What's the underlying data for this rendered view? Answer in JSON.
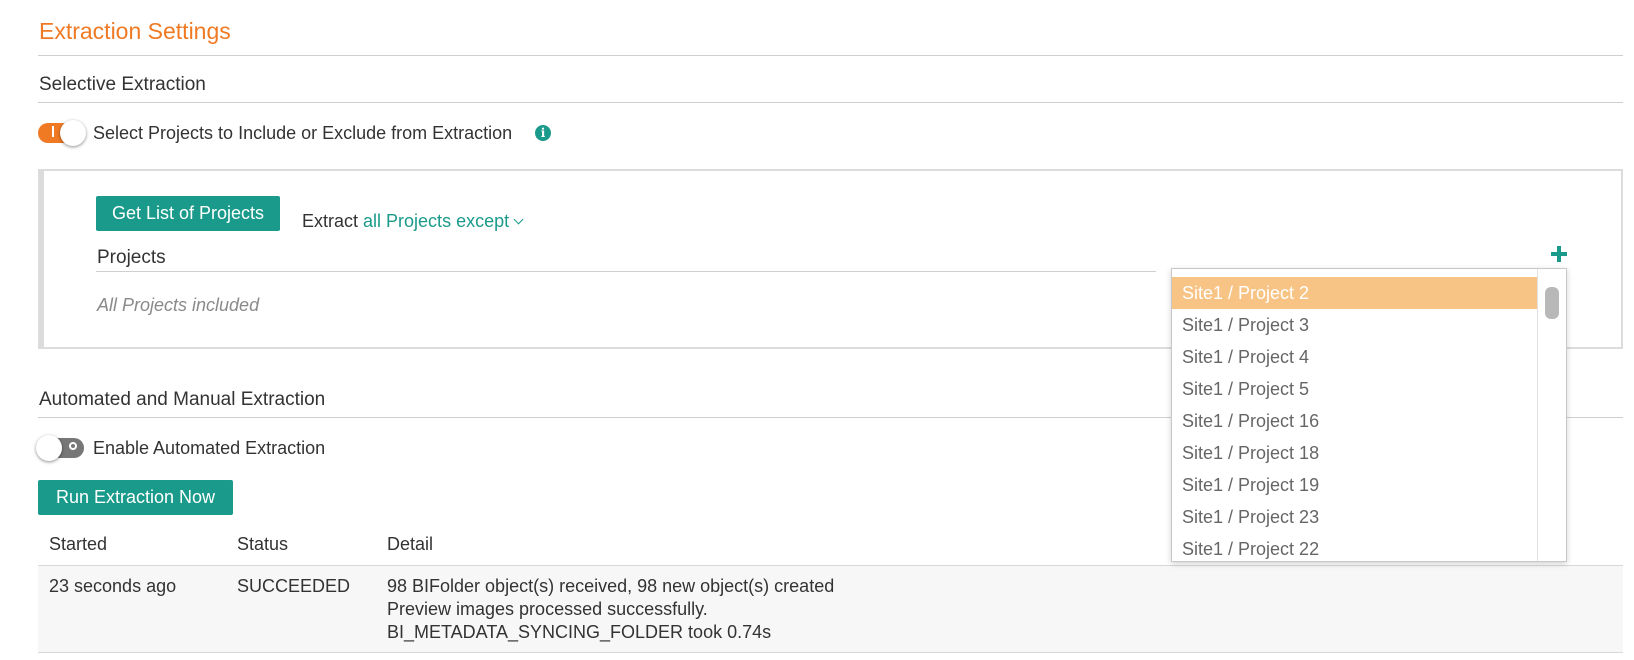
{
  "page": {
    "title": "Extraction Settings"
  },
  "selective": {
    "heading": "Selective Extraction",
    "toggle_state": "on",
    "toggle_label": "Select Projects to Include or Exclude from Extraction",
    "info_icon": "info-icon",
    "get_list_button": "Get List of Projects",
    "extract_prefix": "Extract",
    "extract_mode": "all Projects except",
    "projects_heading": "Projects",
    "projects_empty": "All Projects included",
    "add_icon": "plus-icon"
  },
  "dropdown": {
    "selected_index": 0,
    "items": [
      "Site1 / Project 2",
      "Site1 / Project 3",
      "Site1 / Project 4",
      "Site1 / Project 5",
      "Site1 / Project 16",
      "Site1 / Project 18",
      "Site1 / Project 19",
      "Site1 / Project 23",
      "Site1 / Project 22"
    ]
  },
  "automated": {
    "heading": "Automated and Manual Extraction",
    "toggle_state": "off",
    "toggle_label": "Enable Automated Extraction",
    "run_button": "Run Extraction Now"
  },
  "history": {
    "columns": [
      "Started",
      "Status",
      "Detail"
    ],
    "rows": [
      {
        "started": "23 seconds ago",
        "status": "SUCCEEDED",
        "detail": [
          "98 BIFolder object(s) received, 98 new object(s) created",
          "Preview images processed successfully.",
          "BI_METADATA_SYNCING_FOLDER took 0.74s"
        ]
      }
    ]
  },
  "colors": {
    "accent_orange": "#f07a24",
    "accent_teal": "#1a9a8a",
    "dropdown_highlight": "#f8c486"
  }
}
